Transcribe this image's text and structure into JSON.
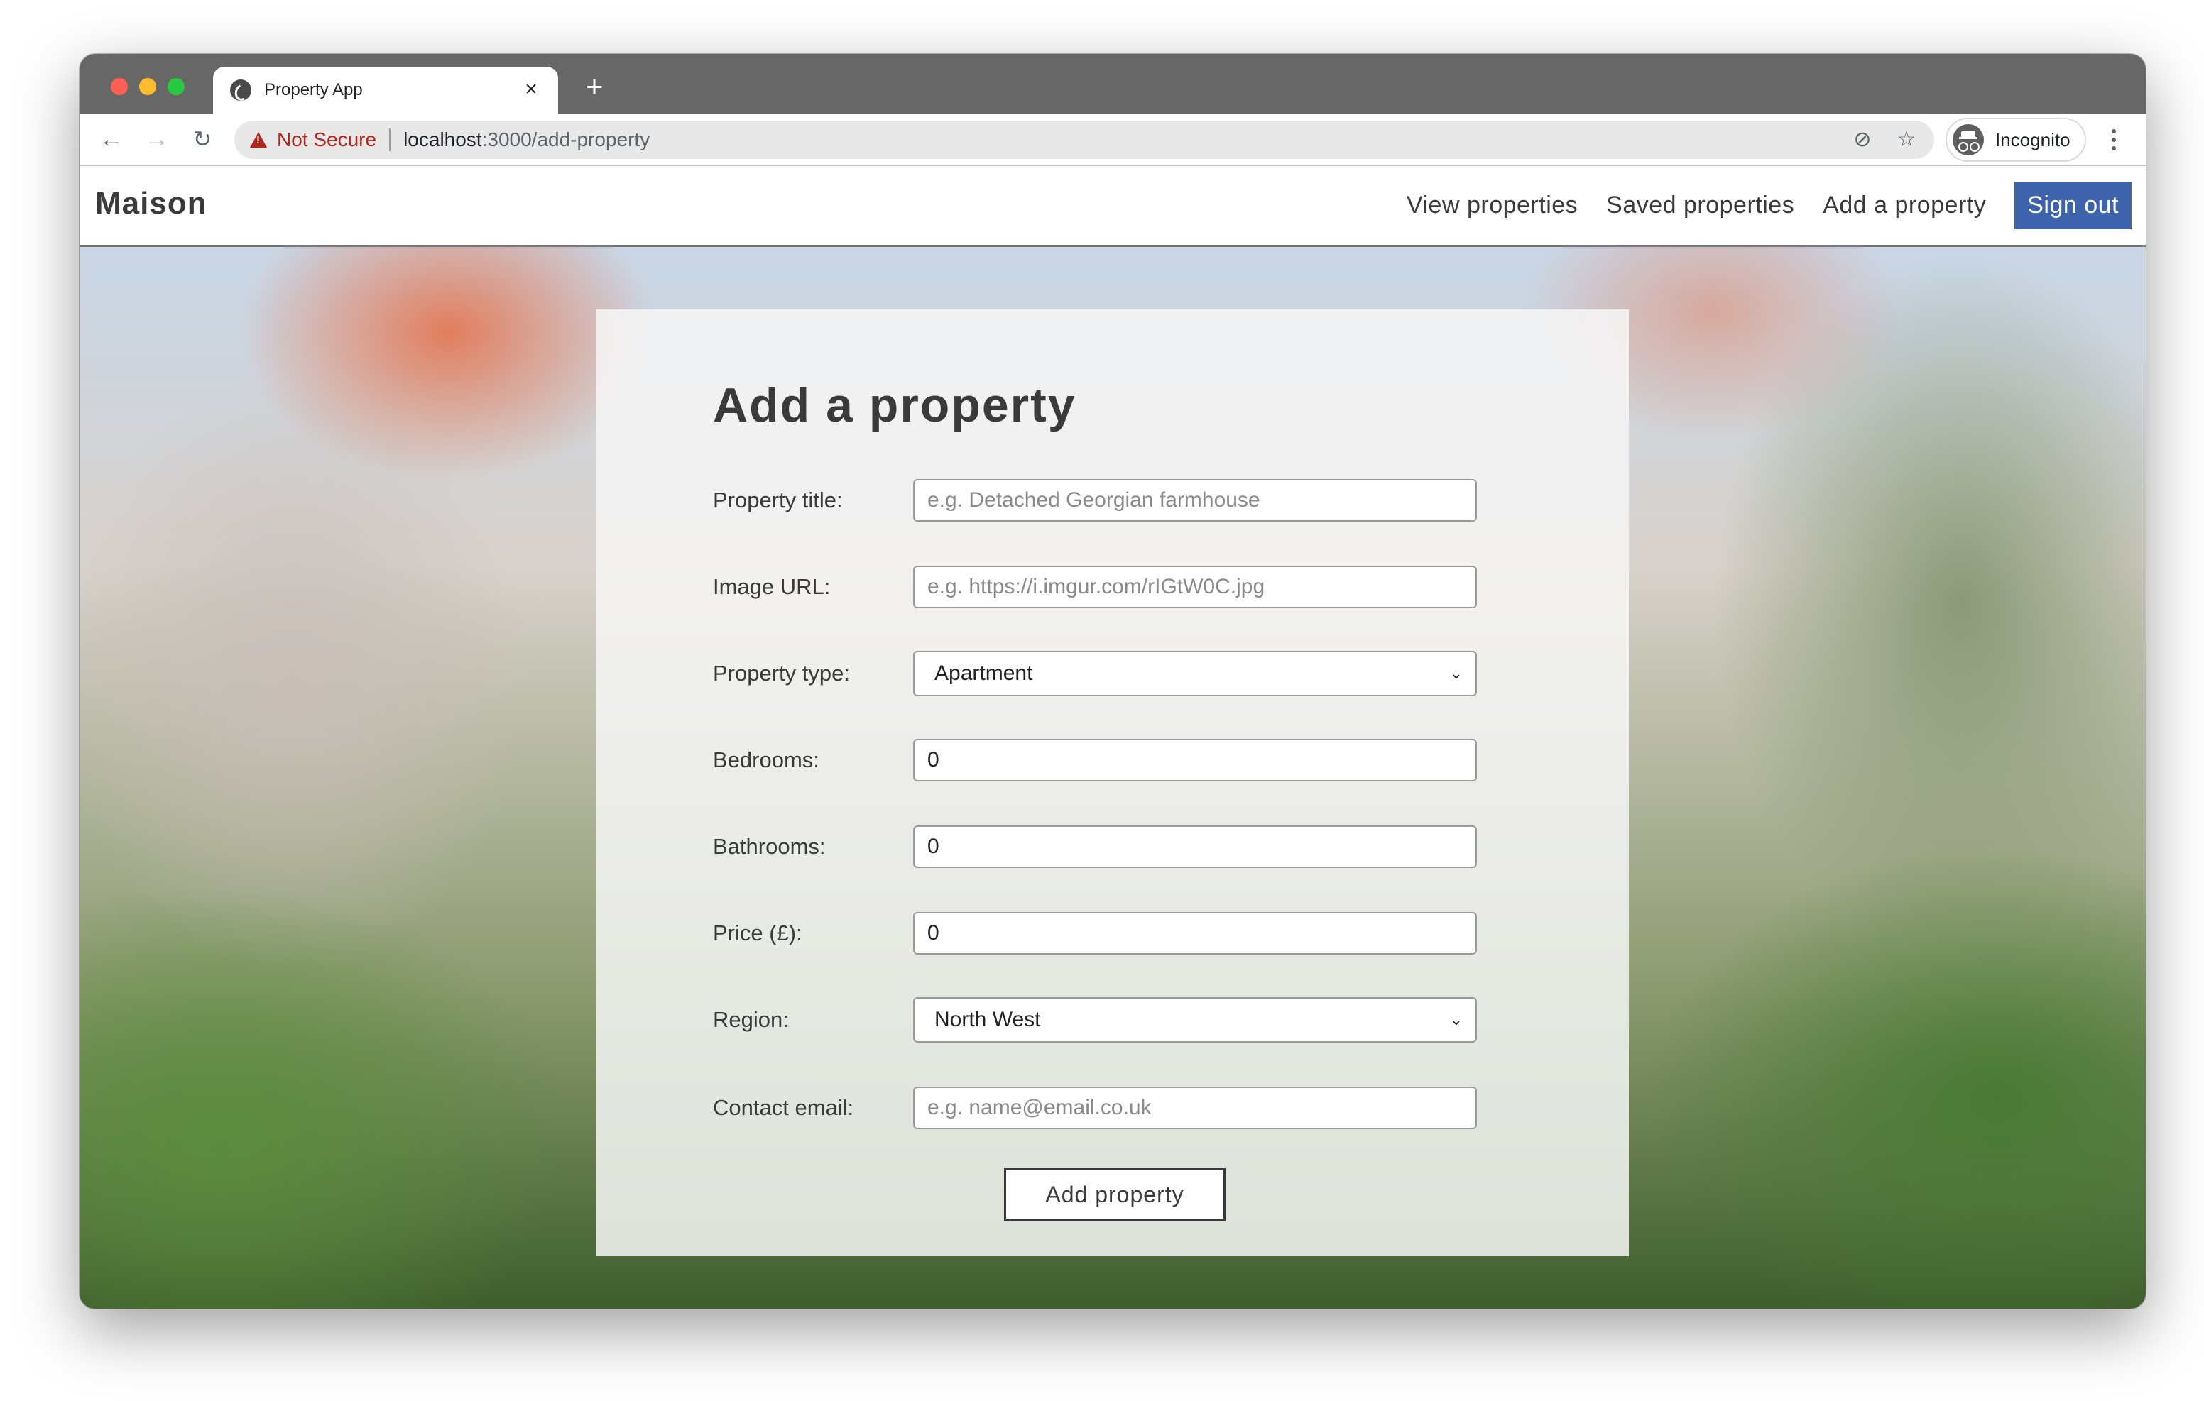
{
  "browser": {
    "tab_title": "Property App",
    "tab_close": "×",
    "new_tab": "+",
    "security_label": "Not Secure",
    "url_host": "localhost",
    "url_path": ":3000/add-property",
    "profile_label": "Incognito",
    "icons": {
      "back": "←",
      "forward": "→",
      "reload": "↻",
      "eye_off": "⊘",
      "star": "☆"
    }
  },
  "app": {
    "brand": "Maison",
    "nav": {
      "view": "View properties",
      "saved": "Saved properties",
      "add": "Add a property",
      "signout": "Sign out"
    },
    "accent_color": "#3d63ad"
  },
  "form": {
    "title": "Add a property",
    "fields": {
      "title": {
        "label": "Property title:",
        "value": "",
        "placeholder": "e.g. Detached Georgian farmhouse"
      },
      "image": {
        "label": "Image URL:",
        "value": "",
        "placeholder": "e.g. https://i.imgur.com/rIGtW0C.jpg"
      },
      "type": {
        "label": "Property type:",
        "value": "Apartment"
      },
      "bedrooms": {
        "label": "Bedrooms:",
        "value": "0"
      },
      "bathrooms": {
        "label": "Bathrooms:",
        "value": "0"
      },
      "price": {
        "label": "Price (£):",
        "value": "0"
      },
      "region": {
        "label": "Region:",
        "value": "North West"
      },
      "email": {
        "label": "Contact email:",
        "value": "",
        "placeholder": "e.g. name@email.co.uk"
      }
    },
    "chevron": "⌄",
    "submit_label": "Add property"
  }
}
